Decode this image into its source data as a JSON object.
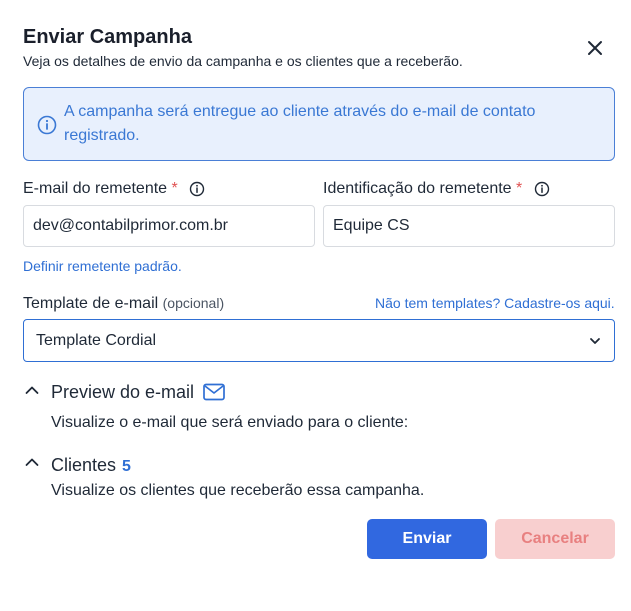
{
  "dialog": {
    "title": "Enviar Campanha",
    "subtitle": "Veja os detalhes de envio da campanha e os clientes que a receberão.",
    "close_icon": "close-icon"
  },
  "info": {
    "icon": "info-icon",
    "text": "A campanha será entregue ao cliente através do e-mail de contato registrado."
  },
  "sender_email": {
    "label": "E-mail do remetente",
    "required_mark": "*",
    "value": "dev@contabilprimor.com.br",
    "help_icon": "info-icon"
  },
  "sender_id": {
    "label": "Identificação do remetente",
    "required_mark": "*",
    "value": "Equipe CS",
    "help_icon": "info-icon"
  },
  "default_sender_link": "Definir remetente padrão.",
  "template": {
    "label": "Template de e-mail",
    "optional": "(opcional)",
    "link": "Não tem templates? Cadastre-os aqui.",
    "selected": "Template Cordial"
  },
  "preview": {
    "title": "Preview do e-mail",
    "icon": "mail-icon",
    "description": "Visualize o e-mail que será enviado para o cliente:"
  },
  "clients": {
    "title": "Clientes",
    "count": "5",
    "description": "Visualize os clientes que receberão essa campanha."
  },
  "actions": {
    "send": "Enviar",
    "cancel": "Cancelar"
  },
  "colors": {
    "primary": "#3168e0",
    "link": "#2f6fd4",
    "info_bg": "#e8f0fd",
    "required": "#e05252",
    "cancel_bg": "#f8cfcf"
  }
}
